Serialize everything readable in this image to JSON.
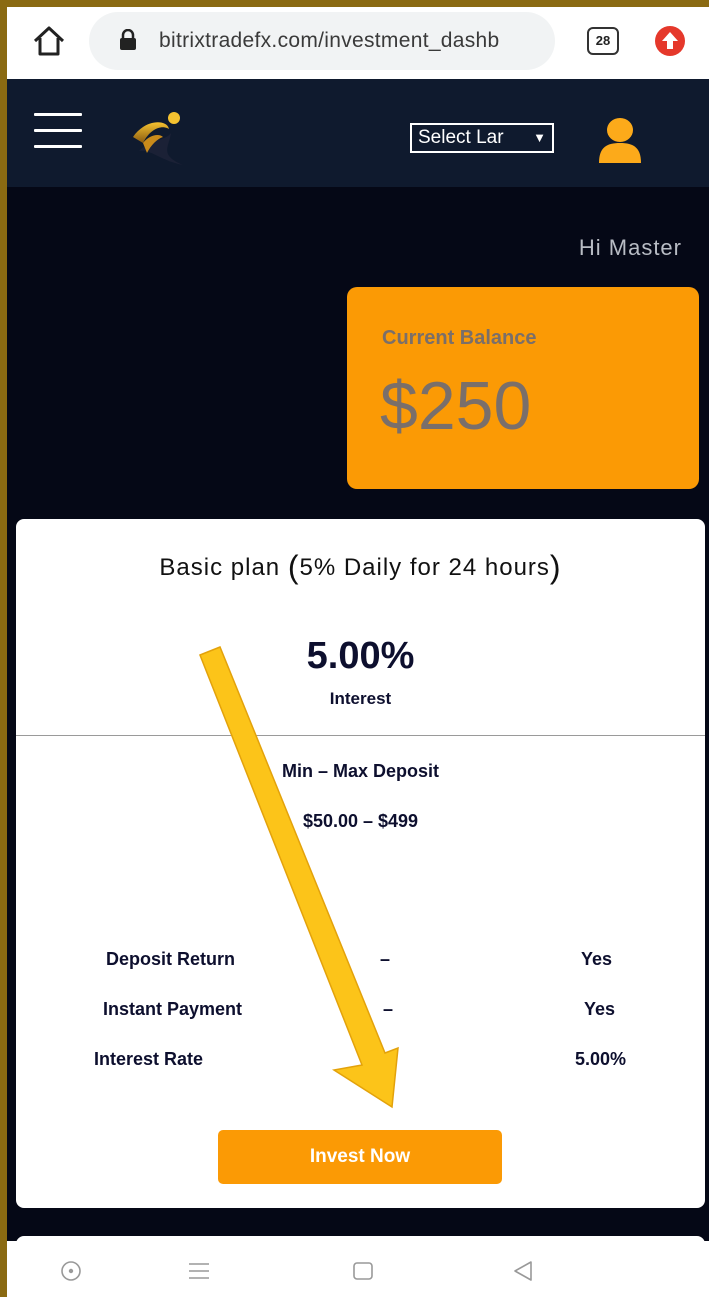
{
  "browser": {
    "url": "bitrixtradefx.com/investment_dashb",
    "tab_count": "28"
  },
  "header": {
    "language_select": "Select Lar",
    "language_arrow": "▼"
  },
  "greeting": "Hi Master",
  "balance": {
    "label": "Current Balance",
    "amount": "$250"
  },
  "plan": {
    "title_prefix": "Basic plan",
    "title_detail": "5% Daily for 24 hours",
    "rate": "5.00%",
    "rate_label": "Interest",
    "deposit_label": "Min – Max Deposit",
    "deposit_range": "$50.00 – $499",
    "features": [
      {
        "label": "Deposit Return",
        "sep": "–",
        "value": "Yes"
      },
      {
        "label": "Instant Payment",
        "sep": "–",
        "value": "Yes"
      },
      {
        "label": "Interest Rate",
        "sep": "",
        "value": "5.00%"
      }
    ],
    "invest_button": "Invest Now"
  },
  "colors": {
    "accent": "#fb9a05",
    "header_bg": "#0f1a2e",
    "page_bg": "#050816",
    "arrow": "#fcc419"
  },
  "icons": {
    "home": "home-icon",
    "lock": "lock-icon",
    "upload": "upload-icon",
    "menu": "hamburger-icon",
    "user": "user-icon"
  }
}
